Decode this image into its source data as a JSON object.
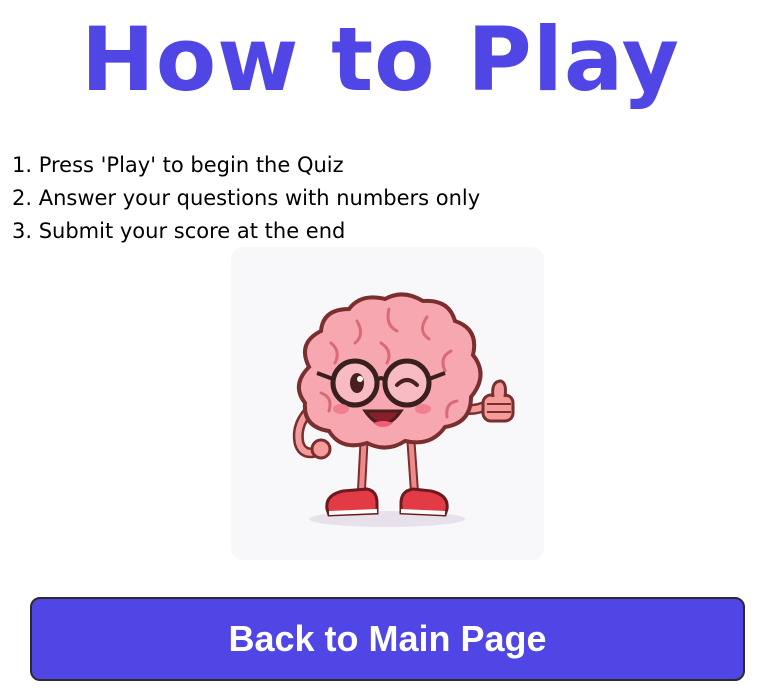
{
  "page": {
    "title": "How to Play"
  },
  "instructions": [
    "1. Press 'Play' to begin the Quiz",
    "2. Answer your questions with numbers only",
    "3. Submit your score at the end"
  ],
  "mascot": {
    "icon": "brain-mascot-icon"
  },
  "actions": {
    "back_label": "Back to Main Page"
  },
  "colors": {
    "accent": "#4f46e5",
    "text": "#000000",
    "button_text": "#ffffff"
  }
}
